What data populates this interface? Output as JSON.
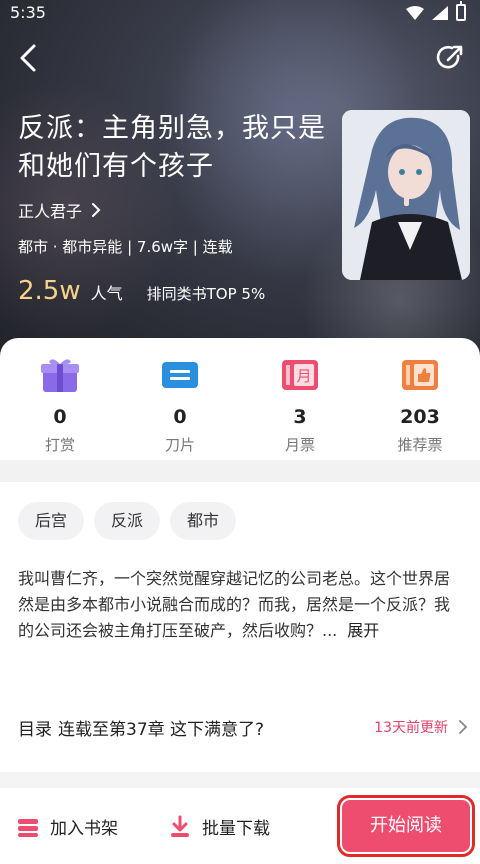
{
  "status_bar": {
    "time": "5:35"
  },
  "book": {
    "title": "反派：主角别急，我只是和她们有个孩子",
    "author": "正人君子",
    "meta": "都市 · 都市异能 | 7.6w字 | 连载",
    "popularity": "2.5w",
    "popularity_label": "人气",
    "rank": "排同类书TOP 5%"
  },
  "metrics": [
    {
      "icon": "gift-icon",
      "value": "0",
      "label": "打赏",
      "color": "#8a6ae6"
    },
    {
      "icon": "blade-ticket-icon",
      "value": "0",
      "label": "刀片",
      "color": "#2b8fe0"
    },
    {
      "icon": "monthly-ticket-icon",
      "value": "3",
      "label": "月票",
      "color": "#ef4d6f"
    },
    {
      "icon": "recommend-ticket-icon",
      "value": "203",
      "label": "推荐票",
      "color": "#f08040"
    }
  ],
  "tags": [
    "后宫",
    "反派",
    "都市"
  ],
  "description": {
    "text": "我叫曹仁齐，一个突然觉醒穿越记忆的公司老总。这个世界居然是由多本都市小说融合而成的？而我，居然是一个反派？我的公司还会被主角打压至破产，然后收购？...",
    "expand": "展开"
  },
  "toc": {
    "label": "目录",
    "latest": "连载至第37章 这下满意了?",
    "updated": "13天前更新"
  },
  "bottom_bar": {
    "shelf": "加入书架",
    "download": "批量下载",
    "read": "开始阅读"
  },
  "colors": {
    "accent": "#ef4d6f",
    "popularity": "#f3d48a"
  }
}
